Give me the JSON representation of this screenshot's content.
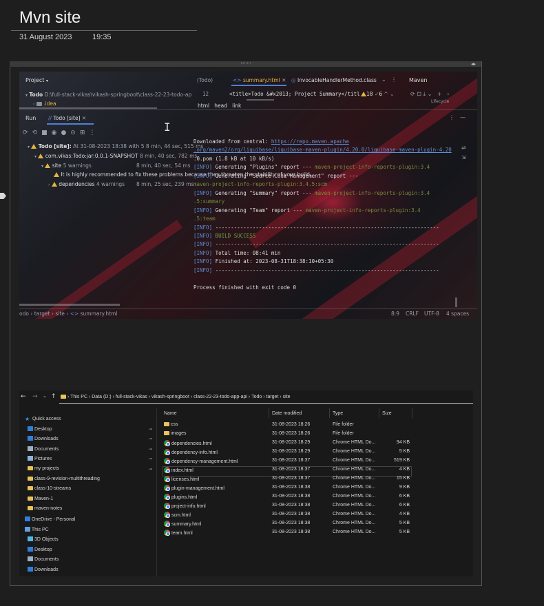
{
  "note": {
    "title": "Mvn site",
    "date": "31 August 2023",
    "time": "19:35"
  },
  "ide": {
    "project_label": "Project",
    "project_root": "Todo",
    "project_path": "D:\\full-stack-vikas\\vikash-springboot\\class-22-23-todo-ap",
    "project_idea": ".idea",
    "editor_tabs": [
      "(Todo)",
      "summary.html",
      "InvocableHandlerMethod.class"
    ],
    "editor_line_no": "12",
    "editor_line": "<title>Todo &#x2013; Project Summary</titl",
    "warn_counts": "18",
    "check_count": "6",
    "maven_label": "Maven",
    "maven_lifecycle": "Lifecycle",
    "breadcrumb_html": [
      "html",
      "head",
      "link"
    ],
    "run_label": "Run",
    "run_tab": "Todo [site]",
    "tree": [
      {
        "label": "Todo [site]:",
        "detail": "At 31-08-2023 18:38 with 5 8 min, 44 sec, 515 ms"
      },
      {
        "label": "com.vikas:Todo:jar:0.0.1-SNAPSHOT",
        "detail": "8 min, 40 sec, 782 ms"
      },
      {
        "label": "site",
        "warnings": "5 warnings",
        "detail": "8 min, 40 sec, 54 ms"
      },
      {
        "label": "It is highly recommended to fix these problems because they threaten the stability of your build.",
        "detail": ""
      },
      {
        "label": "dependencies",
        "warnings": "4 warnings",
        "detail": "8 min, 25 sec, 239 ms"
      }
    ],
    "console": [
      {
        "text": "Downloaded from central: ",
        "link": "https://repo.maven.apache"
      },
      {
        "link": ".org/maven2/org/liquibase/liquibase-maven-plugin/4.20.0/liquibase-maven-plugin-4.20"
      },
      {
        "text": ".0.pom (1.8 kB at 10 kB/s)"
      },
      {
        "info": "[INFO]",
        "text": " Generating \"Plugins\" report       --- ",
        "plugin": "maven-project-info-reports-plugin:3.4"
      },
      {
        "info": "[INFO]",
        "text": " Generating \"Source Code Management\" report ---"
      },
      {
        "plugin": " maven-project-info-reports-plugin:3.4.5:scm"
      },
      {
        "info": "[INFO]",
        "text": " Generating \"Summary\" report       --- ",
        "plugin": "maven-project-info-reports-plugin:3.4"
      },
      {
        "plugin": ".5:summary"
      },
      {
        "info": "[INFO]",
        "text": " Generating \"Team\" report          --- ",
        "plugin": "maven-project-info-reports-plugin:3.4"
      },
      {
        "plugin": ".5:team"
      },
      {
        "info": "[INFO]",
        "text": " ------------------------------------------------------------------------"
      },
      {
        "info": "[INFO]",
        "success": " BUILD SUCCESS"
      },
      {
        "info": "[INFO]",
        "text": " ------------------------------------------------------------------------"
      },
      {
        "info": "[INFO]",
        "text": " Total time:  08:41 min"
      },
      {
        "info": "[INFO]",
        "text": " Finished at: 2023-08-31T18:38:10+05:30"
      },
      {
        "info": "[INFO]",
        "text": " ------------------------------------------------------------------------"
      },
      {
        "text": ""
      },
      {
        "text": "Process finished with exit code 0"
      }
    ],
    "bottom_breadcrumb": [
      "odo",
      "target",
      "site",
      "summary.html"
    ],
    "status": {
      "position": "8:9",
      "line_sep": "CRLF",
      "encoding": "UTF-8",
      "indent": "4 spaces"
    }
  },
  "explorer": {
    "address": [
      "This PC",
      "Data (D:)",
      "full-stack-vikas",
      "vikash-springboot",
      "class-22-23-todo-app-api",
      "Todo",
      "target",
      "site"
    ],
    "columns": [
      "Name",
      "Date modified",
      "Type",
      "Size"
    ],
    "nav_items": [
      {
        "label": "Quick access",
        "icon": "star-icon",
        "color": "#3a8ee6"
      },
      {
        "label": "Desktop",
        "icon": "desktop-icon",
        "color": "#2f7fd8",
        "pinned": true
      },
      {
        "label": "Downloads",
        "icon": "download-icon",
        "color": "#2f7fd8",
        "pinned": true
      },
      {
        "label": "Documents",
        "icon": "documents-icon",
        "color": "#9ab0c8",
        "pinned": true
      },
      {
        "label": "Pictures",
        "icon": "pictures-icon",
        "color": "#8ab4e0",
        "pinned": true
      },
      {
        "label": "my projects",
        "icon": "folder-icon",
        "color": "#e8c35a",
        "pinned": true
      },
      {
        "label": "class-9-revision-multithreading",
        "icon": "folder-icon",
        "color": "#e8c35a"
      },
      {
        "label": "class-10-streams",
        "icon": "folder-icon",
        "color": "#e8c35a"
      },
      {
        "label": "Maven-1",
        "icon": "folder-icon",
        "color": "#e8c35a"
      },
      {
        "label": "maven-notes",
        "icon": "folder-icon",
        "color": "#e8c35a"
      },
      {
        "label": "OneDrive - Personal",
        "icon": "onedrive-icon",
        "color": "#2f7fd8"
      },
      {
        "label": "This PC",
        "icon": "pc-icon",
        "color": "#5fa0e0"
      },
      {
        "label": "3D Objects",
        "icon": "cube-icon",
        "color": "#4fb8e8"
      },
      {
        "label": "Desktop",
        "icon": "desktop-icon",
        "color": "#2f7fd8"
      },
      {
        "label": "Documents",
        "icon": "documents-icon",
        "color": "#9ab0c8"
      },
      {
        "label": "Downloads",
        "icon": "download-icon",
        "color": "#2f7fd8"
      }
    ],
    "files": [
      {
        "name": "css",
        "date": "31-08-2023 18:26",
        "type": "File folder",
        "size": "",
        "kind": "folder"
      },
      {
        "name": "images",
        "date": "31-08-2023 18:26",
        "type": "File folder",
        "size": "",
        "kind": "folder"
      },
      {
        "name": "dependencies.html",
        "date": "31-08-2023 18:29",
        "type": "Chrome HTML Do...",
        "size": "94 KB",
        "kind": "chrome"
      },
      {
        "name": "dependency-info.html",
        "date": "31-08-2023 18:29",
        "type": "Chrome HTML Do...",
        "size": "5 KB",
        "kind": "chrome"
      },
      {
        "name": "dependency-management.html",
        "date": "31-08-2023 18:37",
        "type": "Chrome HTML Do...",
        "size": "519 KB",
        "kind": "chrome"
      },
      {
        "name": "index.html",
        "date": "31-08-2023 18:37",
        "type": "Chrome HTML Do...",
        "size": "4 KB",
        "kind": "chrome"
      },
      {
        "name": "licenses.html",
        "date": "31-08-2023 18:37",
        "type": "Chrome HTML Do...",
        "size": "15 KB",
        "kind": "chrome"
      },
      {
        "name": "plugin-management.html",
        "date": "31-08-2023 18:38",
        "type": "Chrome HTML Do...",
        "size": "9 KB",
        "kind": "chrome"
      },
      {
        "name": "plugins.html",
        "date": "31-08-2023 18:38",
        "type": "Chrome HTML Do...",
        "size": "6 KB",
        "kind": "chrome"
      },
      {
        "name": "project-info.html",
        "date": "31-08-2023 18:38",
        "type": "Chrome HTML Do...",
        "size": "6 KB",
        "kind": "chrome"
      },
      {
        "name": "scm.html",
        "date": "31-08-2023 18:38",
        "type": "Chrome HTML Do...",
        "size": "4 KB",
        "kind": "chrome"
      },
      {
        "name": "summary.html",
        "date": "31-08-2023 18:38",
        "type": "Chrome HTML Do...",
        "size": "5 KB",
        "kind": "chrome"
      },
      {
        "name": "team.html",
        "date": "31-08-2023 18:38",
        "type": "Chrome HTML Do...",
        "size": "5 KB",
        "kind": "chrome"
      }
    ]
  }
}
